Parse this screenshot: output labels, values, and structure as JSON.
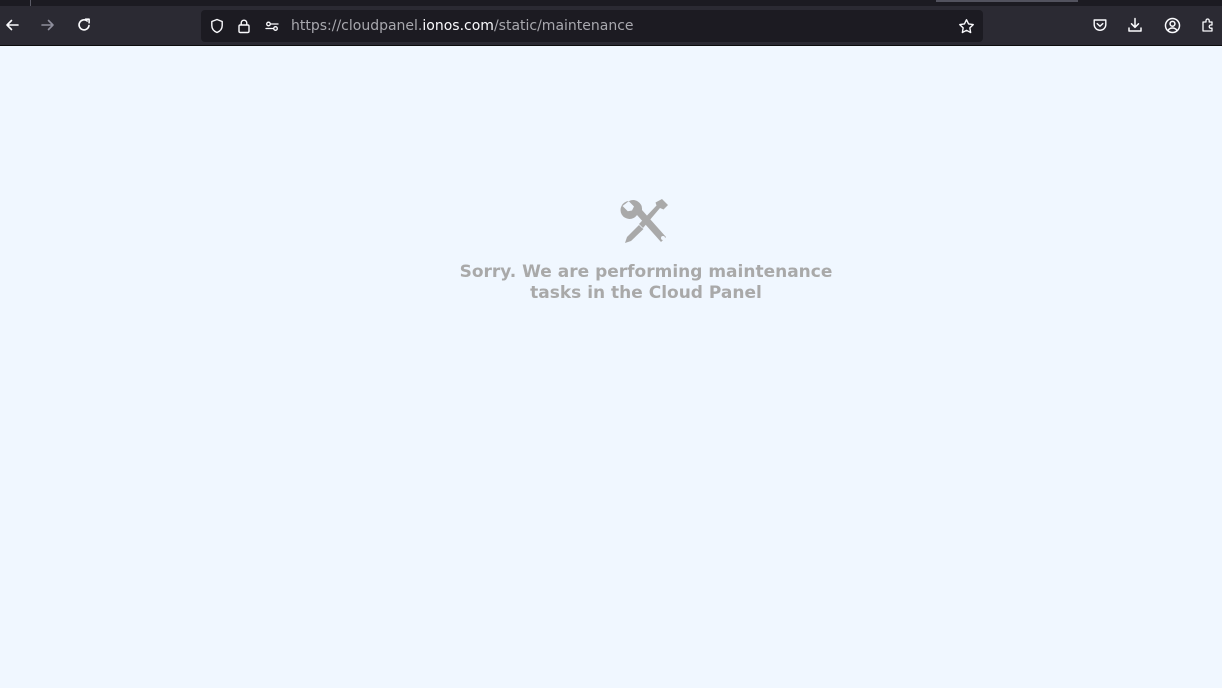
{
  "browser": {
    "url": {
      "scheme_and_subdomain": "https://cloudpanel.",
      "domain": "ionos.com",
      "path": "/static/maintenance"
    },
    "toolbar_icons": [
      "back-arrow-icon",
      "forward-arrow-icon",
      "reload-icon",
      "tracking-shield-icon",
      "lock-icon",
      "permissions-icon",
      "bookmark-star-icon",
      "pocket-icon",
      "downloads-icon",
      "account-icon",
      "extensions-icon"
    ],
    "colors": {
      "toolbar": "#2b2a33",
      "urlbar": "#1c1b22",
      "icon": "#fbfbfe",
      "icon_disabled": "#8f8f9d"
    }
  },
  "page": {
    "icon": "tools-wrench-screwdriver-icon",
    "message_line1": "Sorry. We are performing maintenance",
    "message_line2": "tasks in the Cloud Panel",
    "colors": {
      "background": "#f0f7ff",
      "text": "#a9a9a9"
    }
  }
}
